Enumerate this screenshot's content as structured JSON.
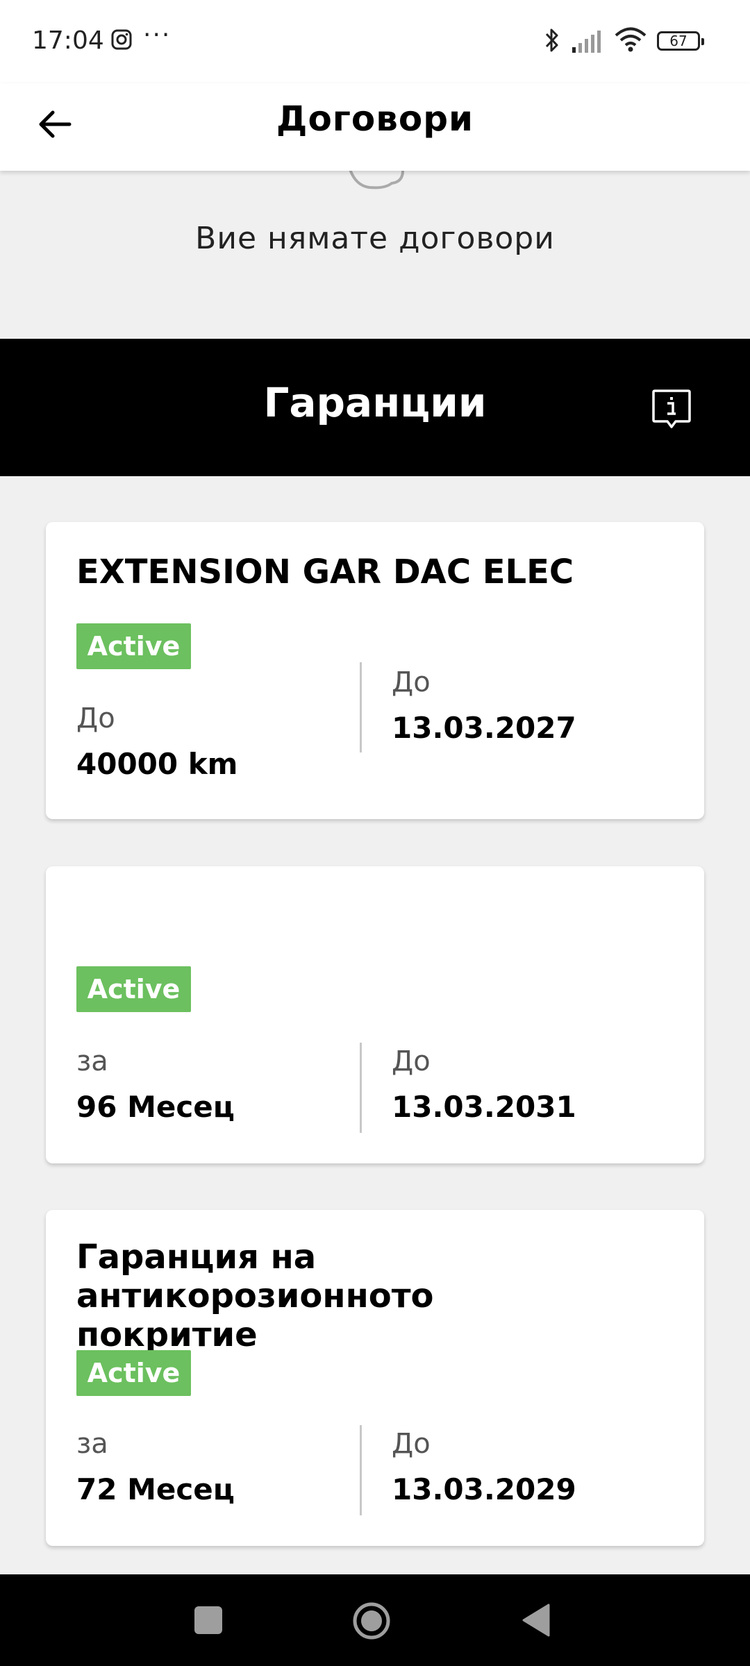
{
  "status_bar": {
    "time": "17:04",
    "overflow": "···",
    "battery": "67",
    "icons": [
      "instagram-icon",
      "bluetooth-icon",
      "signal-icon",
      "wifi-icon",
      "battery-icon"
    ]
  },
  "app_bar": {
    "title": "Договори",
    "back_icon": "arrow-left-icon"
  },
  "contracts": {
    "empty_message": "Вие нямате договори"
  },
  "warranties": {
    "title": "Гаранции",
    "info_icon": "info-icon",
    "cards": [
      {
        "title": "EXTENSION GAR DAC ELEC",
        "status": "Active",
        "left_label": "До",
        "left_value": "40000 km",
        "right_label": "До",
        "right_value": "13.03.2027"
      },
      {
        "title": "",
        "status": "Active",
        "left_label": "за",
        "left_value": "96 Месец",
        "right_label": "До",
        "right_value": "13.03.2031"
      },
      {
        "title": "Гаранция на антикорозионното покритие",
        "status": "Active",
        "left_label": "за",
        "left_value": "72 Месец",
        "right_label": "До",
        "right_value": "13.03.2029"
      }
    ]
  },
  "colors": {
    "active_badge": "#6cc05f",
    "section_header": "#000000",
    "background": "#f0f0f0"
  }
}
